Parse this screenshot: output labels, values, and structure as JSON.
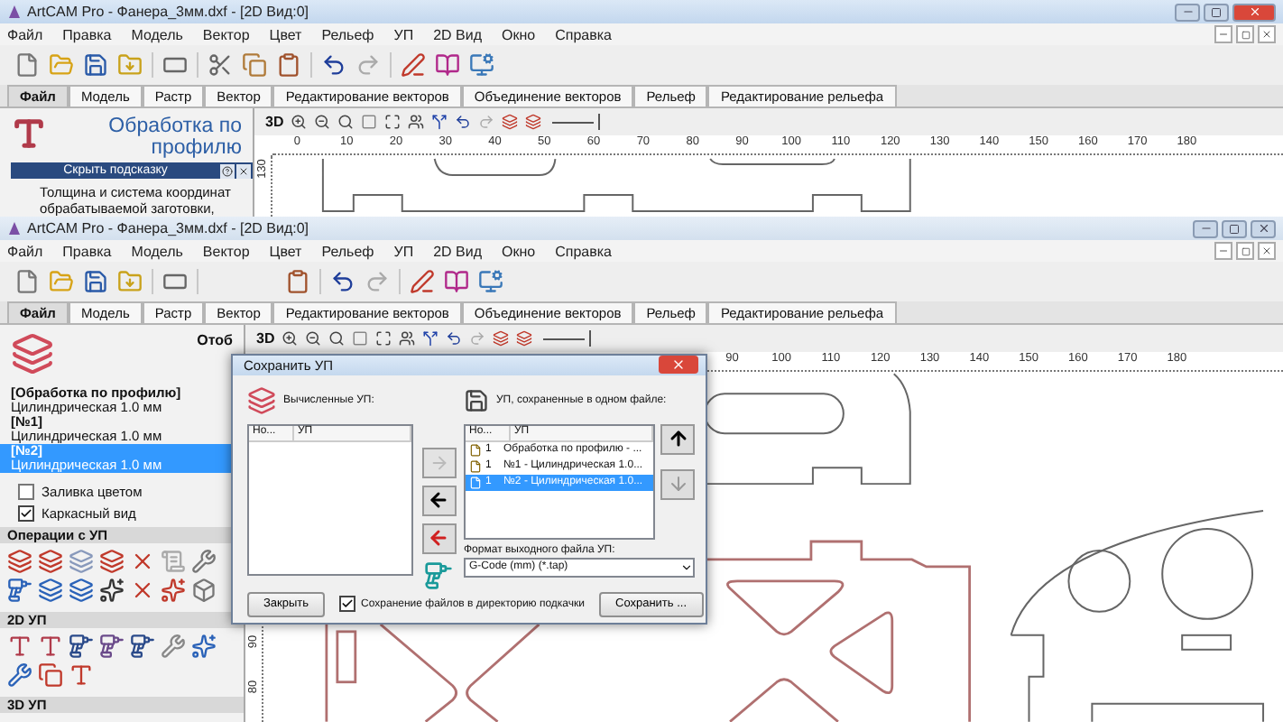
{
  "top_window": {
    "title": "ArtCAM Pro - Фанера_3мм.dxf - [2D Вид:0]",
    "active": true,
    "menu": [
      "Файл",
      "Правка",
      "Модель",
      "Вектор",
      "Цвет",
      "Рельеф",
      "УП",
      "2D Вид",
      "Окно",
      "Справка"
    ],
    "tabs": [
      {
        "label": "Файл",
        "selected": true
      },
      {
        "label": "Модель",
        "selected": false
      },
      {
        "label": "Растр",
        "selected": false
      },
      {
        "label": "Вектор",
        "selected": false
      },
      {
        "label": "Редактирование векторов",
        "selected": false
      },
      {
        "label": "Объединение векторов",
        "selected": false
      },
      {
        "label": "Рельеф",
        "selected": false
      },
      {
        "label": "Редактирование рельефа",
        "selected": false
      }
    ],
    "panel": {
      "heading": "Обработка по профилю",
      "hint_bar": "Скрыть подсказку",
      "hint_text": "Толщина и система координат обрабатываемой заготовки,"
    },
    "view_mode": "3D",
    "ruler": [
      "0",
      "10",
      "20",
      "30",
      "40",
      "50",
      "60",
      "70",
      "80",
      "90",
      "100",
      "110",
      "120",
      "130",
      "140",
      "150",
      "160",
      "170",
      "180"
    ],
    "vertical_ruler": [
      "130"
    ]
  },
  "bottom_window": {
    "title": "ArtCAM Pro - Фанера_3мм.dxf - [2D Вид:0]",
    "active": false,
    "menu": [
      "Файл",
      "Правка",
      "Модель",
      "Вектор",
      "Цвет",
      "Рельеф",
      "УП",
      "2D Вид",
      "Окно",
      "Справка"
    ],
    "tabs": [
      {
        "label": "Файл",
        "selected": true
      },
      {
        "label": "Модель",
        "selected": false
      },
      {
        "label": "Растр",
        "selected": false
      },
      {
        "label": "Вектор",
        "selected": false
      },
      {
        "label": "Редактирование векторов",
        "selected": false
      },
      {
        "label": "Объединение векторов",
        "selected": false
      },
      {
        "label": "Рельеф",
        "selected": false
      },
      {
        "label": "Редактирование рельефа",
        "selected": false
      }
    ],
    "panel": {
      "cut_label": "Отоб",
      "toolpaths": [
        {
          "label": "[Обработка по профилю]",
          "selected": false,
          "children": [
            {
              "label": "Цилиндрическая 1.0 мм",
              "selected": false
            }
          ]
        },
        {
          "label": "[№1]",
          "selected": false,
          "children": [
            {
              "label": "Цилиндрическая 1.0 мм",
              "selected": false
            }
          ]
        },
        {
          "label": "[№2]",
          "selected": true,
          "children": [
            {
              "label": "Цилиндрическая 1.0 мм",
              "selected": true
            }
          ]
        }
      ],
      "options": [
        {
          "label": "Заливка цветом",
          "checked": false
        },
        {
          "label": "Каркасный вид",
          "checked": true
        }
      ],
      "sections": [
        "Операции с УП",
        "2D УП",
        "3D УП"
      ]
    },
    "view_mode": "3D",
    "ruler": [
      "90",
      "100",
      "110",
      "120",
      "130",
      "140",
      "150",
      "160",
      "170",
      "180"
    ],
    "vertical_ruler": [
      "90",
      "80"
    ]
  },
  "dialog": {
    "title": "Сохранить УП",
    "computed_label": "Вычисленные УП:",
    "saved_label": "УП, сохраненные в одном файле:",
    "computed_columns": [
      "Но...",
      "УП"
    ],
    "saved_columns": [
      "Но...",
      "УП"
    ],
    "saved_rows": [
      {
        "number": "1",
        "name": "Обработка по профилю - ...",
        "selected": false
      },
      {
        "number": "1",
        "name": "№1 - Цилиндрическая 1.0...",
        "selected": false
      },
      {
        "number": "1",
        "name": "№2 - Цилиндрическая 1.0...",
        "selected": true
      }
    ],
    "format_label": "Формат выходного файла УП:",
    "format_value": "G-Code (mm) (*.tap)",
    "close_button": "Закрыть",
    "save_to_temp": {
      "label": "Сохранение файлов в директорию подкачки",
      "checked": true
    },
    "save_button": "Сохранить ..."
  }
}
